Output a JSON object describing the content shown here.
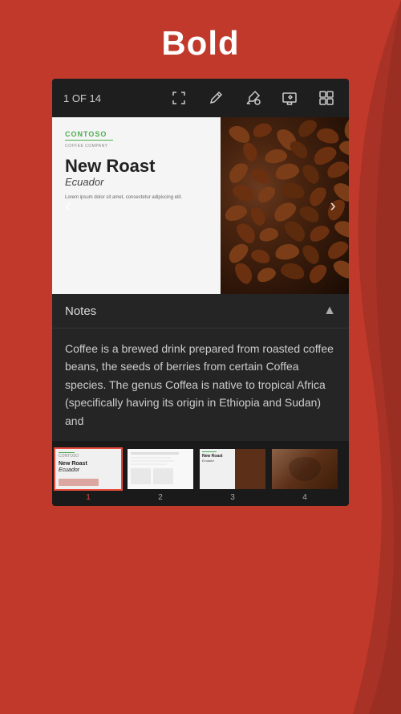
{
  "header": {
    "title": "Bold",
    "bg_color": "#c0392b"
  },
  "toolbar": {
    "slide_counter": "1 OF 14",
    "icons": [
      "expand",
      "pencil",
      "highlight",
      "present",
      "grid"
    ]
  },
  "slide": {
    "left_panel": {
      "logo": "CONTOSO",
      "logo_sub": "COFFEE COMPANY",
      "title": "New Roast",
      "subtitle": "Ecuador",
      "body_text": "Lorem ipsum dolor sit amet, consectetur adipiscing elit."
    },
    "right_panel": {
      "description": "Coffee beans photo"
    },
    "nav_prev": "‹",
    "nav_next": "›"
  },
  "notes": {
    "label": "Notes",
    "chevron": "▲",
    "content": "Coffee is a brewed drink prepared from roasted coffee beans, the seeds of berries from certain Coffea species. The genus Coffea is native to tropical Africa (specifically having its origin in Ethiopia and Sudan) and"
  },
  "thumbnails": [
    {
      "number": "1",
      "active": true,
      "type": "new-roast"
    },
    {
      "number": "2",
      "active": false,
      "type": "text"
    },
    {
      "number": "3",
      "active": false,
      "type": "new-roast-variant"
    },
    {
      "number": "4",
      "active": false,
      "type": "coffee-hands"
    }
  ]
}
